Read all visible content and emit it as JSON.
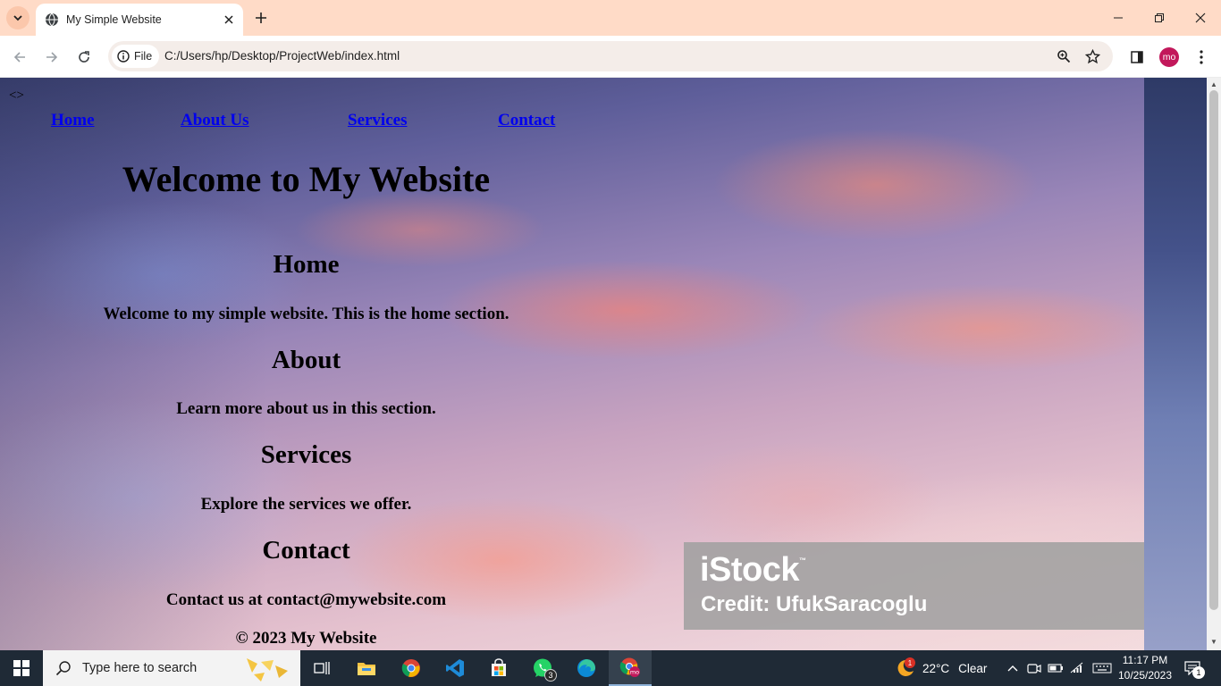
{
  "browser": {
    "tab_title": "My Simple Website",
    "site_chip_label": "File",
    "url": "C:/Users/hp/Desktop/ProjectWeb/index.html",
    "profile_initials": "mo"
  },
  "page": {
    "stray_text": "<>",
    "nav": {
      "home": "Home",
      "about": "About Us",
      "services": "Services",
      "contact": "Contact"
    },
    "heading": "Welcome to My Website",
    "sections": {
      "home": {
        "title": "Home",
        "text": "Welcome to my simple website. This is the home section."
      },
      "about": {
        "title": "About",
        "text": "Learn more about us in this section."
      },
      "services": {
        "title": "Services",
        "text": "Explore the services we offer."
      },
      "contact": {
        "title": "Contact",
        "text": "Contact us at contact@mywebsite.com"
      }
    },
    "footer": "© 2023 My Website",
    "watermark": {
      "logo": "iStock",
      "tm": "™",
      "credit": "Credit: UfukSaracoglu"
    }
  },
  "taskbar": {
    "search_placeholder": "Type here to search",
    "whatsapp_badge": "3",
    "weather_badge": "1",
    "weather_temp": "22°C",
    "weather_condition": "Clear",
    "time": "11:17 PM",
    "date": "10/25/2023",
    "notification_count": "1"
  }
}
